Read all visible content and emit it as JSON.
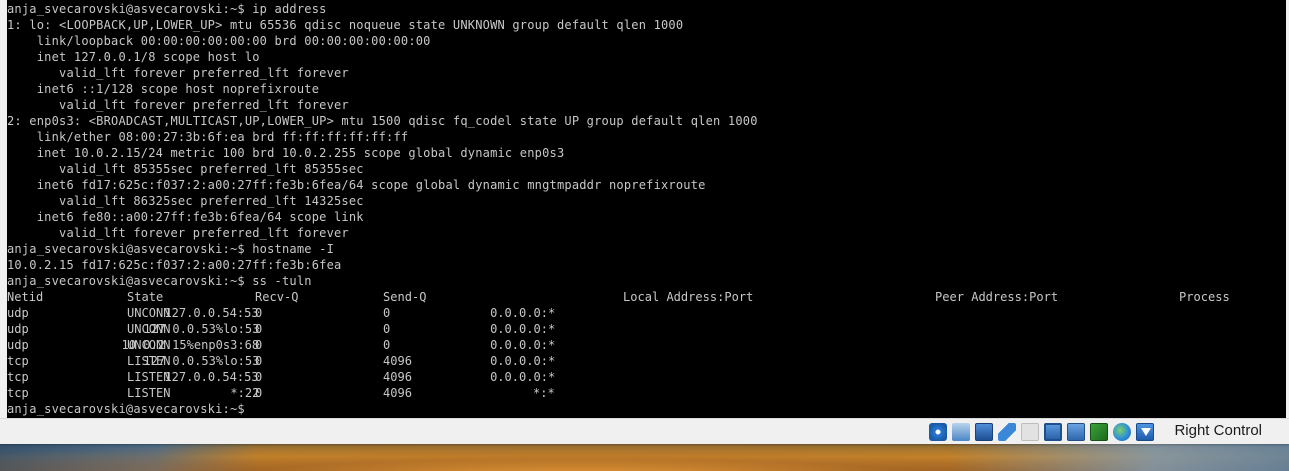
{
  "terminal": {
    "lines": [
      "anja_svecarovski@asvecarovski:~$ ip address",
      "1: lo: <LOOPBACK,UP,LOWER_UP> mtu 65536 qdisc noqueue state UNKNOWN group default qlen 1000",
      "    link/loopback 00:00:00:00:00:00 brd 00:00:00:00:00:00",
      "    inet 127.0.0.1/8 scope host lo",
      "       valid_lft forever preferred_lft forever",
      "    inet6 ::1/128 scope host noprefixroute",
      "       valid_lft forever preferred_lft forever",
      "2: enp0s3: <BROADCAST,MULTICAST,UP,LOWER_UP> mtu 1500 qdisc fq_codel state UP group default qlen 1000",
      "    link/ether 08:00:27:3b:6f:ea brd ff:ff:ff:ff:ff:ff",
      "    inet 10.0.2.15/24 metric 100 brd 10.0.2.255 scope global dynamic enp0s3",
      "       valid_lft 85355sec preferred_lft 85355sec",
      "    inet6 fd17:625c:f037:2:a00:27ff:fe3b:6fea/64 scope global dynamic mngtmpaddr noprefixroute",
      "       valid_lft 86325sec preferred_lft 14325sec",
      "    inet6 fe80::a00:27ff:fe3b:6fea/64 scope link",
      "       valid_lft forever preferred_lft forever",
      "anja_svecarovski@asvecarovski:~$ hostname -I",
      "10.0.2.15 fd17:625c:f037:2:a00:27ff:fe3b:6fea",
      "anja_svecarovski@asvecarovski:~$ ss -tuln"
    ],
    "ss_header": {
      "netid": "Netid",
      "state": "State",
      "recv_q": "Recv-Q",
      "send_q": "Send-Q",
      "local": "Local Address:Port",
      "peer": "Peer Address:Port",
      "process": "Process"
    },
    "ss_rows": [
      {
        "netid": "udp",
        "state": "UNCONN",
        "recv_q": "0",
        "send_q": "0",
        "local": "127.0.0.54:53",
        "peer": "0.0.0.0:*"
      },
      {
        "netid": "udp",
        "state": "UNCONN",
        "recv_q": "0",
        "send_q": "0",
        "local": "127.0.0.53%lo:53",
        "peer": "0.0.0.0:*"
      },
      {
        "netid": "udp",
        "state": "UNCONN",
        "recv_q": "0",
        "send_q": "0",
        "local": "10.0.2.15%enp0s3:68",
        "peer": "0.0.0.0:*"
      },
      {
        "netid": "tcp",
        "state": "LISTEN",
        "recv_q": "0",
        "send_q": "4096",
        "local": "127.0.0.53%lo:53",
        "peer": "0.0.0.0:*"
      },
      {
        "netid": "tcp",
        "state": "LISTEN",
        "recv_q": "0",
        "send_q": "4096",
        "local": "127.0.0.54:53",
        "peer": "0.0.0.0:*"
      },
      {
        "netid": "tcp",
        "state": "LISTEN",
        "recv_q": "0",
        "send_q": "4096",
        "local": "*:22",
        "peer": "*:*"
      }
    ],
    "prompt": "anja_svecarovski@asvecarovski:~$"
  },
  "statusbar": {
    "icons": [
      "optical-disk-icon",
      "shared-folder-network-icon",
      "display-window-icon",
      "usb-pencil-icon",
      "audio-blank-icon",
      "monitor-icon",
      "network-adapters-icon",
      "cpu-chip-icon",
      "globe-icon",
      "mouse-integration-arrow-icon"
    ],
    "host_key_label": "Right Control"
  }
}
